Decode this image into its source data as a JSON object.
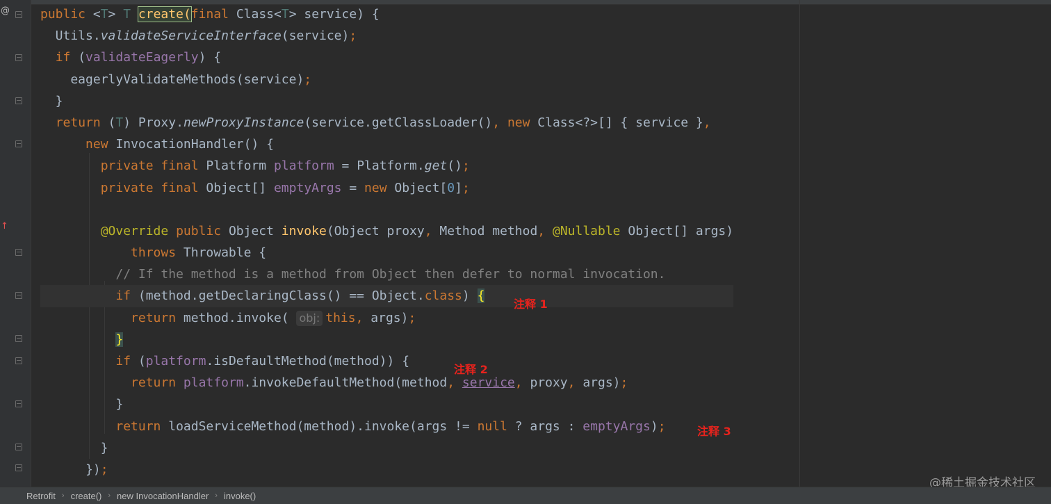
{
  "editor": {
    "lines": [
      "public <T> T create(final Class<T> service) {",
      "  Utils.validateServiceInterface(service);",
      "  if (validateEagerly) {",
      "    eagerlyValidateMethods(service);",
      "  }",
      "  return (T) Proxy.newProxyInstance(service.getClassLoader(), new Class<?>[] { service },",
      "      new InvocationHandler() {",
      "        private final Platform platform = Platform.get();",
      "        private final Object[] emptyArgs = new Object[0];",
      "",
      "        @Override public Object invoke(Object proxy, Method method, @Nullable Object[] args)",
      "            throws Throwable {",
      "          // If the method is a method from Object then defer to normal invocation.",
      "          if (method.getDeclaringClass() == Object.class) {",
      "            return method.invoke( obj: this, args);",
      "          }",
      "          if (platform.isDefaultMethod(method)) {",
      "            return platform.invokeDefaultMethod(method, service, proxy, args);",
      "          }",
      "          return loadServiceMethod(method).invoke(args != null ? args : emptyArgs);",
      "        }",
      "      });"
    ],
    "hint_obj": "obj:"
  },
  "annotations": {
    "note1": "注释 1",
    "note2": "注释 2",
    "note3": "注释 3"
  },
  "gutter": {
    "at_mark": "@",
    "arrow_mark": "↑"
  },
  "breadcrumb": {
    "items": [
      "Retrofit",
      "create()",
      "new InvocationHandler",
      "invoke()"
    ],
    "separator": "›"
  },
  "watermark": "@稀土掘金技术社区",
  "colors": {
    "background": "#2b2b2b",
    "keyword": "#cc7832",
    "method_decl": "#ffc66d",
    "field": "#9876aa",
    "annotation": "#bbb529",
    "number": "#6897bb",
    "comment": "#808080",
    "note_red": "#e8231d"
  }
}
